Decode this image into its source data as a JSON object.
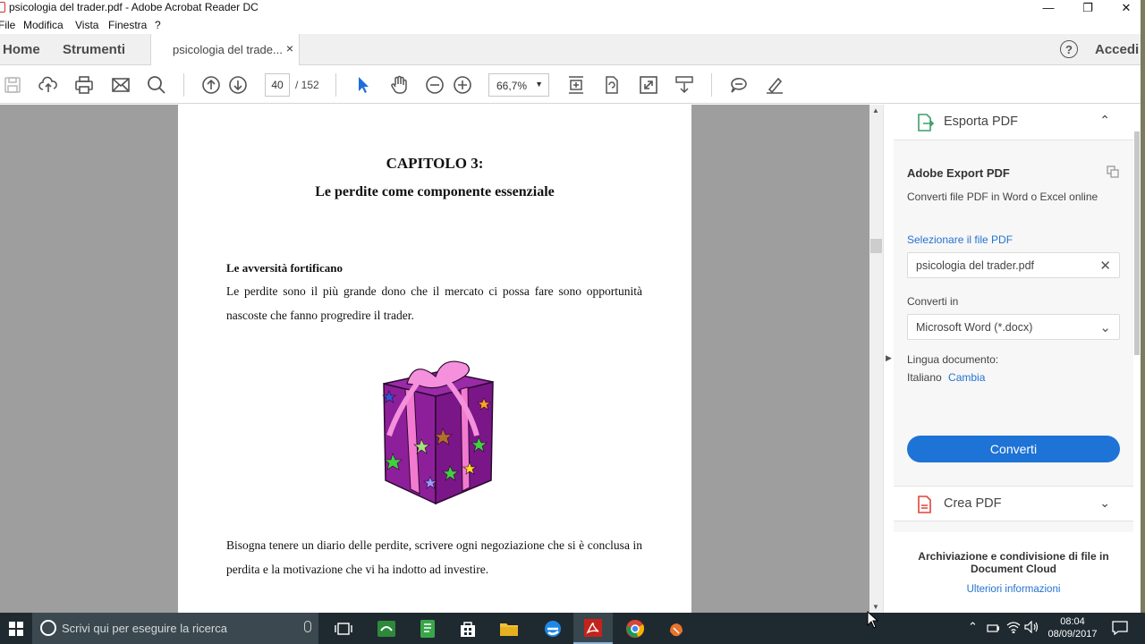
{
  "window": {
    "title": "psicologia del trader.pdf - Adobe Acrobat Reader DC",
    "minimize_glyph": "—",
    "restore_glyph": "❐",
    "close_glyph": "✕"
  },
  "menu": [
    "File",
    "Modifica",
    "Vista",
    "Finestra",
    "?"
  ],
  "nav": {
    "home": "Home",
    "tools": "Strumenti",
    "tab_label": "psicologia del trade...",
    "tab_close": "×",
    "help_glyph": "?",
    "login": "Accedi"
  },
  "toolbar": {
    "icons": [
      "save-icon",
      "upload-icon",
      "print-icon",
      "email-icon",
      "search-icon",
      "page-up-icon",
      "page-down-icon",
      "select-tool-icon",
      "hand-tool-icon",
      "zoom-out-icon",
      "zoom-in-icon",
      "fit-page-icon",
      "rotate-icon",
      "fullscreen-icon",
      "scroll-mode-icon",
      "comment-icon",
      "highlight-icon"
    ],
    "page_current": "40",
    "page_total": "/  152",
    "zoom": "66,7%",
    "zoom_caret": "▼"
  },
  "document": {
    "chapter": "CAPITOLO 3:",
    "subtitle": "Le perdite come componente essenziale",
    "heading": "Le avversità fortificano",
    "para1": "Le perdite sono il più grande dono che il mercato ci possa fare sono opportunità nascoste che fanno progredire il trader.",
    "para2": "Bisogna tenere un diario delle perdite, scrivere ogni negoziazione che si è conclusa in perdita e la motivazione che vi ha indotto ad investire."
  },
  "scrollbar": {
    "up": "▲",
    "down": "▼",
    "panel_toggle": "▶"
  },
  "panel": {
    "section_title": "Esporta PDF",
    "section_chevron": "⌃",
    "service_title": "Adobe Export PDF",
    "service_desc": "Converti file PDF in Word o Excel online",
    "select_file_label": "Selezionare il file PDF",
    "selected_file": "psicologia del trader.pdf",
    "clear_glyph": "✕",
    "convert_to_label": "Converti in",
    "convert_to_value": "Microsoft Word (*.docx)",
    "dropdown_glyph": "⌄",
    "language_label": "Lingua documento:",
    "language_value": "Italiano",
    "language_change": "Cambia",
    "convert_button": "Converti",
    "create_pdf": "Crea PDF",
    "create_chevron": "⌄",
    "cloud_text": "Archiviazione e condivisione di file in Document Cloud",
    "cloud_link": "Ulteriori informazioni"
  },
  "taskbar": {
    "search_placeholder": "Scrivi qui per eseguire la ricerca",
    "apps": [
      "task-view-icon",
      "xbox-app-icon",
      "notes-app-icon",
      "store-icon",
      "file-explorer-icon",
      "edge-icon",
      "acrobat-icon",
      "chrome-icon",
      "game-app-icon"
    ],
    "tray_caret": "⌃",
    "time": "08:04",
    "date": "08/09/2017"
  }
}
